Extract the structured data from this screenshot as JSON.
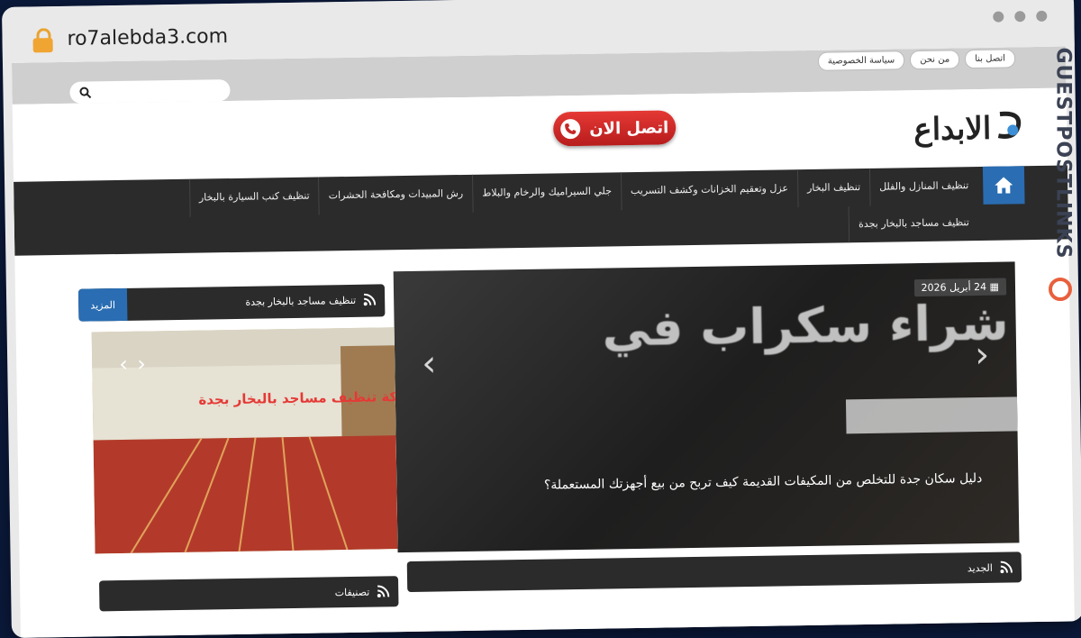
{
  "browser": {
    "url": "ro7alebda3.com"
  },
  "top_links": [
    "اتصل بنا",
    "من نحن",
    "سياسة الخصوصية"
  ],
  "logo": {
    "text": "الابداع"
  },
  "call_button": {
    "label": "اتصل الان"
  },
  "nav": {
    "items": [
      "تنظيف المنازل والفلل",
      "تنظيف البخار",
      "عزل وتعقيم الخزانات وكشف التسريب",
      "جلي السيراميك والرخام والبلاط",
      "رش المبيدات ومكافحة الحشرات",
      "تنظيف كنب السيارة بالبخار"
    ],
    "second_row": "تنظيف مساجد بالبخار بجدة"
  },
  "slider": {
    "date": "24 أبريل 2026",
    "image_text": "شراء سكراب في",
    "caption": "دليل سكان جدة للتخلص من المكيفات القديمة كيف تربح من بيع أجهزتك المستعملة؟"
  },
  "latest": {
    "title": "الجديد"
  },
  "widget": {
    "title": "تنظيف مساجد بالبخار بجدة",
    "more": "المزيد",
    "image_caption": "شركة تنظيف مساجد بالبخار بجدة"
  },
  "categories": {
    "title": "تصنيفات"
  },
  "watermark": {
    "text": "GUESTPOSTLINKS"
  }
}
